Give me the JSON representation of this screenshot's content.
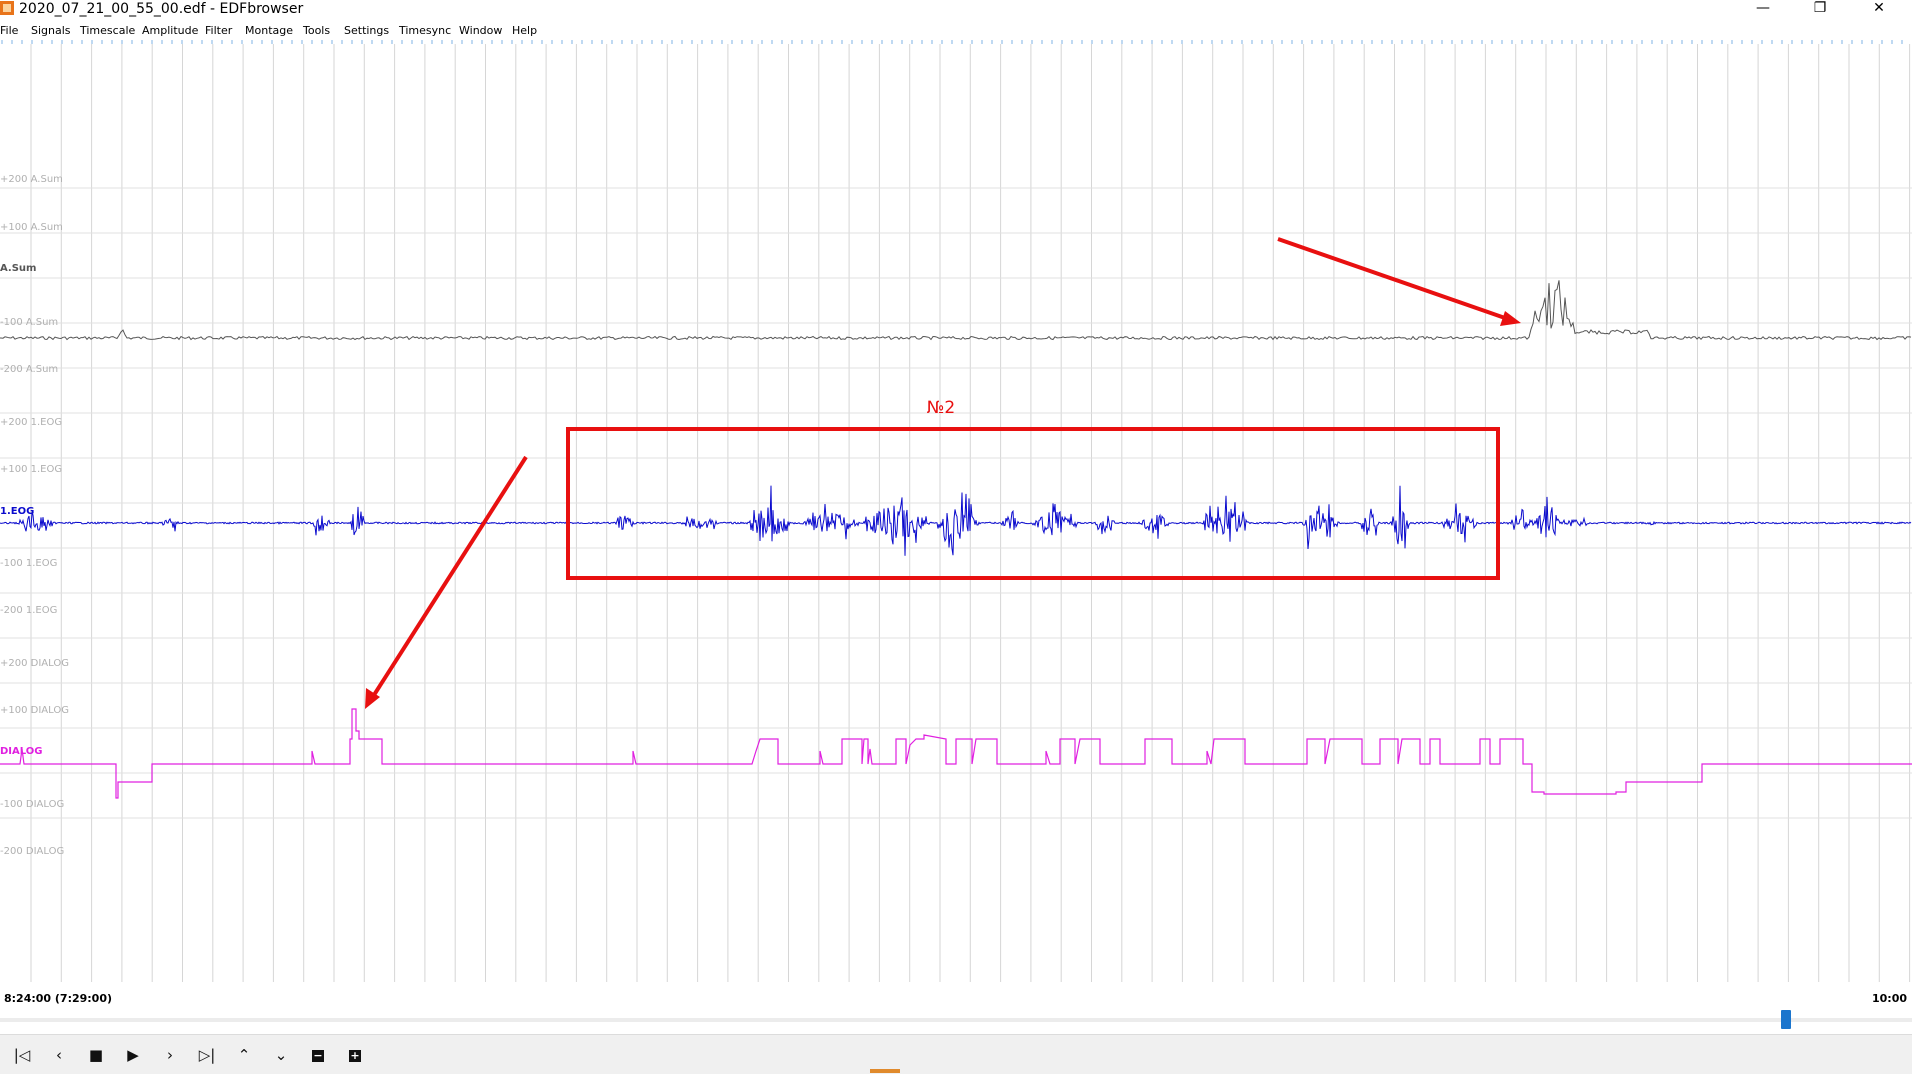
{
  "window": {
    "title": "2020_07_21_00_55_00.edf - EDFbrowser",
    "controls": {
      "minimize": "—",
      "restore": "❐",
      "close": "✕"
    }
  },
  "menu": [
    "File",
    "Signals",
    "Timescale",
    "Amplitude",
    "Filter",
    "Montage",
    "Tools",
    "Settings",
    "Timesync",
    "Window",
    "Help"
  ],
  "signals": [
    {
      "name": "A.Sum",
      "color": "#555555",
      "labels": [
        "+200 A.Sum",
        "+100 A.Sum",
        "A.Sum",
        "-100 A.Sum",
        "-200 A.Sum"
      ]
    },
    {
      "name": "1.EOG",
      "color": "#0a0acd",
      "labels": [
        "+200 1.EOG",
        "+100 1.EOG",
        "1.EOG",
        "-100 1.EOG",
        "-200 1.EOG"
      ]
    },
    {
      "name": "DIALOG",
      "color": "#e020e0",
      "labels": [
        "+200 DIALOG",
        "+100 DIALOG",
        "DIALOG",
        "-100 DIALOG",
        "-200 DIALOG"
      ]
    }
  ],
  "annotations": {
    "box_label": "№2",
    "color": "#e81010"
  },
  "timeline": {
    "start": "8:24:00 (7:29:00)",
    "end": "10:00"
  },
  "colors": {
    "grid": "#c8c8c8",
    "tick": "#7fb3e6",
    "label": "#b0b0b0",
    "scroll_thumb": "#1b75cd"
  },
  "nav_buttons": [
    {
      "id": "first",
      "icon": "skip-start-icon",
      "glyph": "|◁"
    },
    {
      "id": "prev",
      "icon": "chevron-left-icon",
      "glyph": "‹"
    },
    {
      "id": "stop",
      "icon": "stop-icon",
      "glyph": "■"
    },
    {
      "id": "play",
      "icon": "play-icon",
      "glyph": "▶"
    },
    {
      "id": "next",
      "icon": "chevron-right-icon",
      "glyph": "›"
    },
    {
      "id": "last",
      "icon": "skip-end-icon",
      "glyph": "▷|"
    },
    {
      "id": "up",
      "icon": "chevron-up-icon",
      "glyph": "⌃"
    },
    {
      "id": "down",
      "icon": "chevron-down-icon",
      "glyph": "⌄"
    },
    {
      "id": "zoom-out",
      "icon": "zoom-out-icon",
      "glyph": "−"
    },
    {
      "id": "zoom-in",
      "icon": "zoom-in-icon",
      "glyph": "+"
    }
  ]
}
